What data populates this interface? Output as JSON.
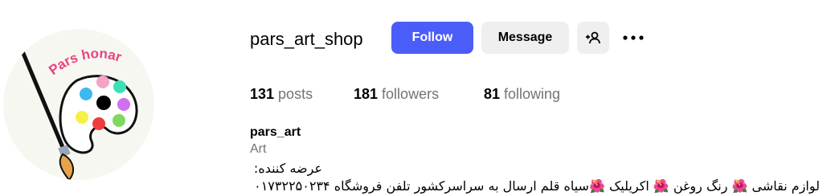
{
  "profile": {
    "username": "pars_art_shop",
    "logo_text": "Pars honar",
    "full_name": "pars_art",
    "category": "Art",
    "bio_line1": "عرضه کننده:",
    "bio_line2": "لوازم نقاشی 🌺 رنگ روغن 🌺 اکریلیک 🌺سیاه قلم ارسال به سراسرکشور تلفن فروشگاه ۰۱۷۳۲۲۵۰۲۳۴"
  },
  "actions": {
    "follow_label": "Follow",
    "message_label": "Message",
    "add_user_icon": "person-plus-icon",
    "more_icon": "ellipsis-icon"
  },
  "stats": {
    "posts_count": "131",
    "posts_label": "posts",
    "followers_count": "181",
    "followers_label": "followers",
    "following_count": "81",
    "following_label": "following"
  },
  "colors": {
    "follow_bg": "#4a5df9",
    "secondary_bg": "#efefef",
    "muted_text": "#737373",
    "logo_text": "#e8437e"
  }
}
